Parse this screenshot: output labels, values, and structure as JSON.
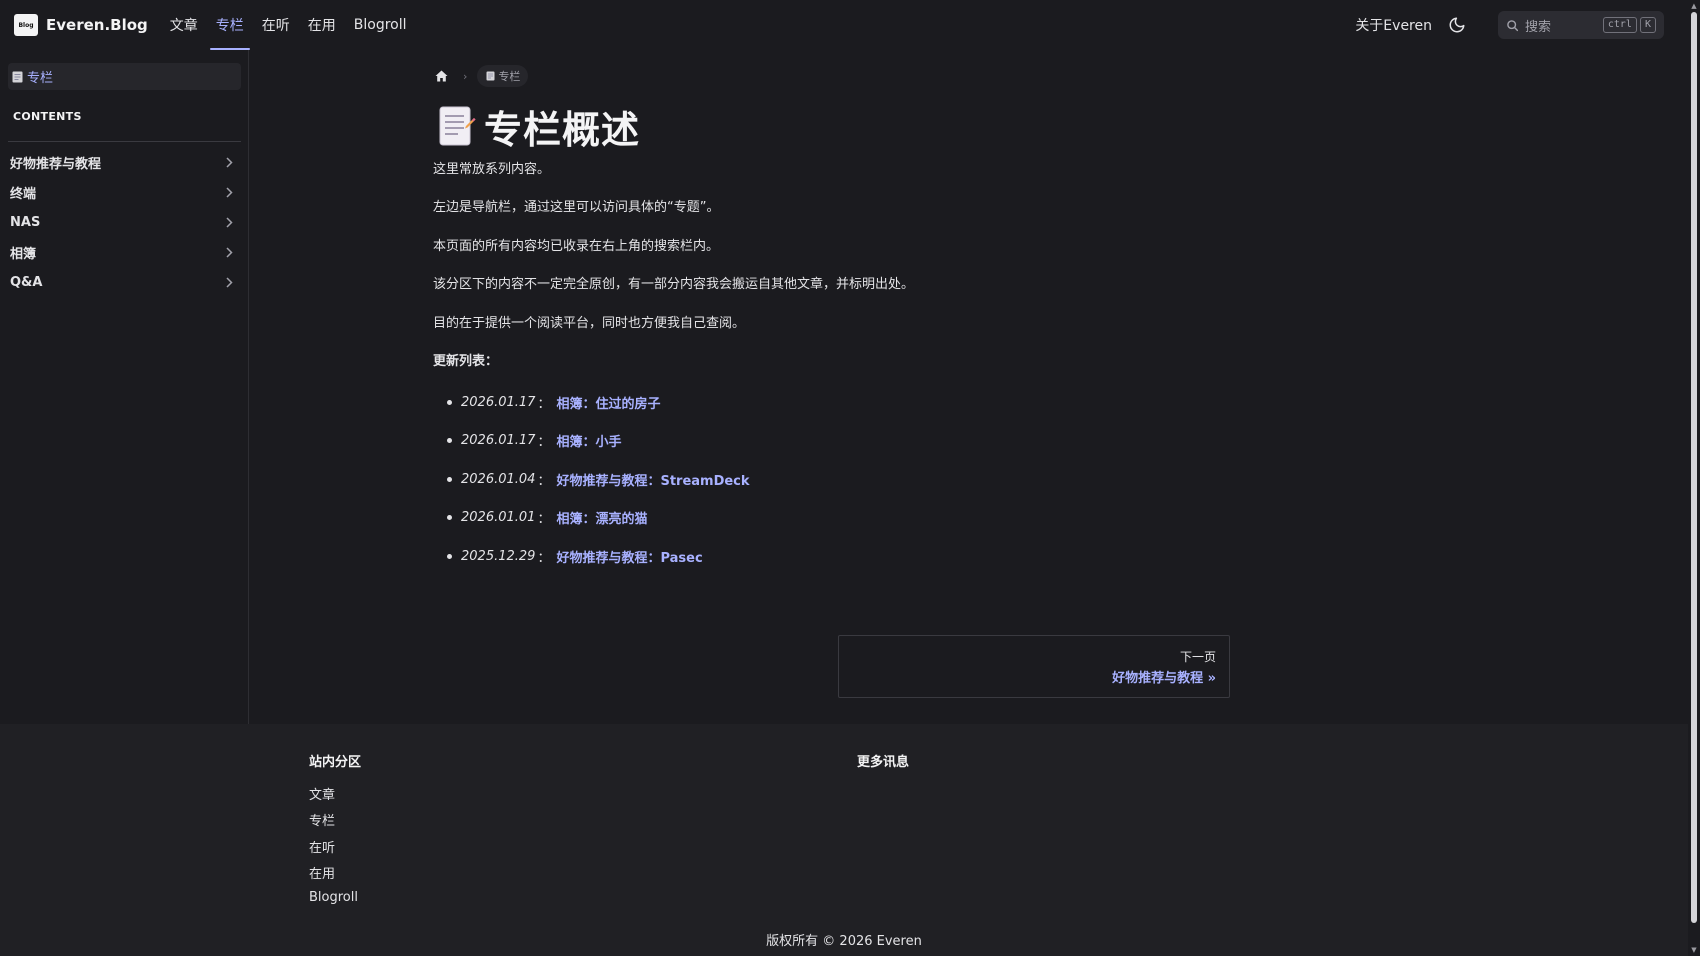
{
  "brand": {
    "logo_text": "Blog",
    "name": "Everen.Blog"
  },
  "nav": {
    "links": [
      {
        "label": "文章",
        "active": false
      },
      {
        "label": "专栏",
        "active": true
      },
      {
        "label": "在听",
        "active": false
      },
      {
        "label": "在用",
        "active": false
      },
      {
        "label": "Blogroll",
        "active": false
      }
    ],
    "about_label": "关于Everen",
    "search_placeholder": "搜索",
    "shortcut_keys": [
      "ctrl",
      "K"
    ]
  },
  "sidebar": {
    "current_label": "专栏",
    "contents_heading": "CONTENTS",
    "items": [
      {
        "label": "好物推荐与教程"
      },
      {
        "label": "终端"
      },
      {
        "label": "NAS"
      },
      {
        "label": "相簿"
      },
      {
        "label": "Q&A"
      }
    ]
  },
  "breadcrumb": {
    "current": "专栏"
  },
  "page": {
    "title": "专栏概述",
    "paragraphs": [
      "这里常放系列内容。",
      "左边是导航栏，通过这里可以访问具体的“专题”。",
      "本页面的所有内容均已收录在右上角的搜索栏内。",
      "该分区下的内容不一定完全原创，有一部分内容我会搬运自其他文章，并标明出处。",
      "目的在于提供一个阅读平台，同时也方便我自己查阅。"
    ],
    "updates_heading": "更新列表：",
    "updates": [
      {
        "date": "2026.01.17",
        "separator": "：",
        "link": "相簿：住过的房子"
      },
      {
        "date": "2026.01.17",
        "separator": "：",
        "link": "相簿：小手"
      },
      {
        "date": "2026.01.04",
        "separator": "：",
        "link": "好物推荐与教程：StreamDeck"
      },
      {
        "date": "2026.01.01",
        "separator": "：",
        "link": "相簿：漂亮的猫"
      },
      {
        "date": "2025.12.29",
        "separator": "：",
        "link": "好物推荐与教程：Pasec"
      }
    ]
  },
  "next_page": {
    "desc": "下一页",
    "title": "好物推荐与教程 »"
  },
  "footer": {
    "col1_title": "站内分区",
    "col1_links": [
      "文章",
      "专栏",
      "在听",
      "在用",
      "Blogroll"
    ],
    "col2_title": "更多讯息",
    "copyright": "版权所有 © 2026 Everen"
  },
  "colors": {
    "accent": "#a8b1ff",
    "background": "#1b1b1f",
    "footer_bg": "#202024"
  }
}
